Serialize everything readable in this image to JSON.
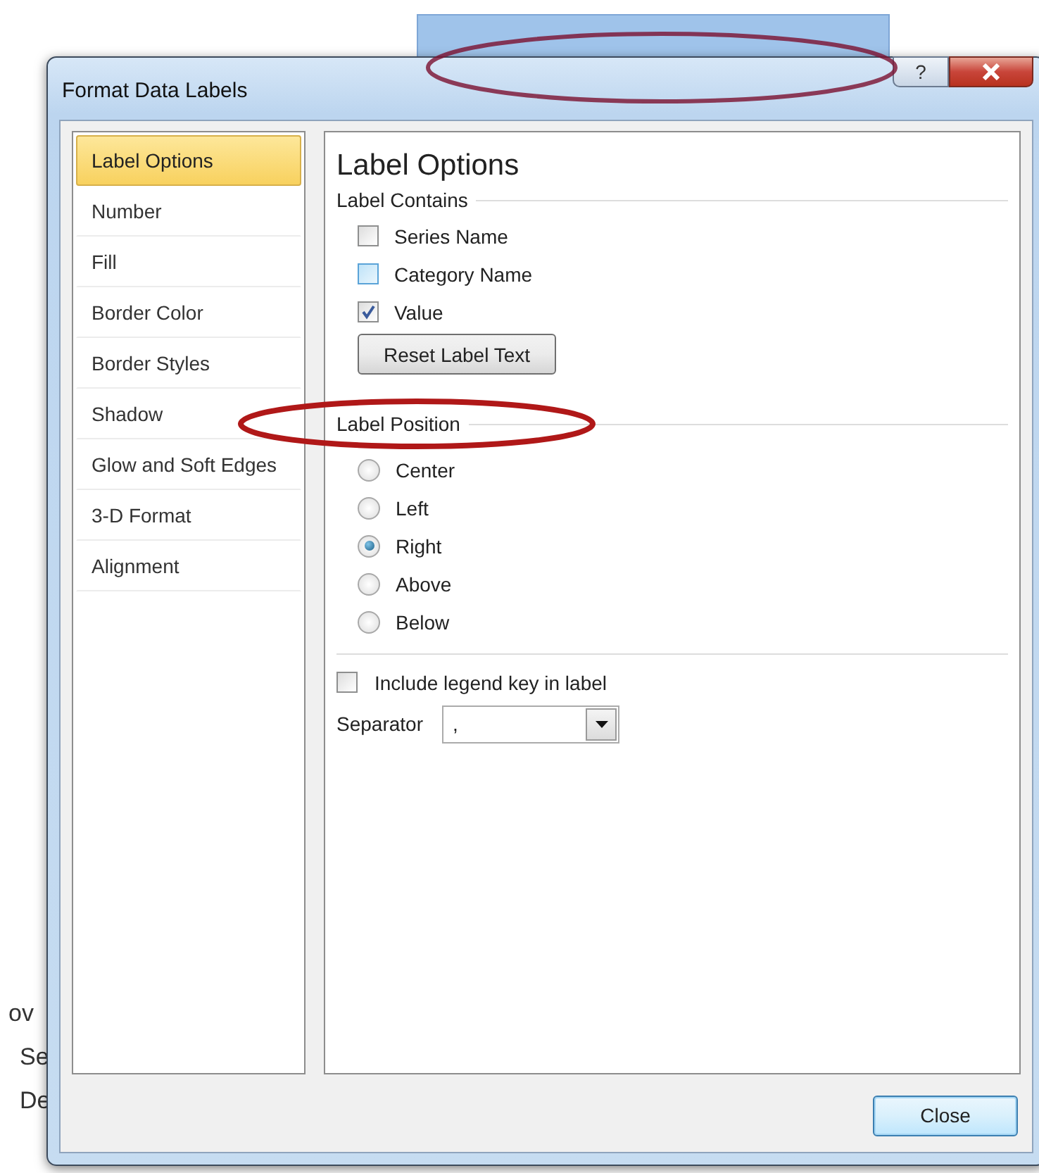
{
  "background": {
    "fragments": [
      "ov",
      "Se",
      "De"
    ]
  },
  "window": {
    "title": "Format Data Labels",
    "help_button": "?"
  },
  "sidebar": {
    "items": [
      {
        "label": "Label Options",
        "selected": true
      },
      {
        "label": "Number",
        "selected": false
      },
      {
        "label": "Fill",
        "selected": false
      },
      {
        "label": "Border Color",
        "selected": false
      },
      {
        "label": "Border Styles",
        "selected": false
      },
      {
        "label": "Shadow",
        "selected": false
      },
      {
        "label": "Glow and Soft Edges",
        "selected": false
      },
      {
        "label": "3-D Format",
        "selected": false
      },
      {
        "label": "Alignment",
        "selected": false
      }
    ]
  },
  "panel": {
    "title": "Label Options",
    "label_contains": {
      "heading": "Label Contains",
      "options": [
        {
          "label": "Series Name",
          "checked": false,
          "hovered": false
        },
        {
          "label": "Category Name",
          "checked": false,
          "hovered": true
        },
        {
          "label": "Value",
          "checked": true,
          "hovered": false
        }
      ],
      "reset_button": "Reset Label Text"
    },
    "label_position": {
      "heading": "Label Position",
      "options": [
        {
          "label": "Center",
          "selected": false
        },
        {
          "label": "Left",
          "selected": false
        },
        {
          "label": "Right",
          "selected": true
        },
        {
          "label": "Above",
          "selected": false
        },
        {
          "label": "Below",
          "selected": false
        }
      ]
    },
    "legend_key": {
      "label": "Include legend key in label",
      "checked": false
    },
    "separator": {
      "label": "Separator",
      "value": ","
    }
  },
  "footer": {
    "close_button": "Close"
  }
}
